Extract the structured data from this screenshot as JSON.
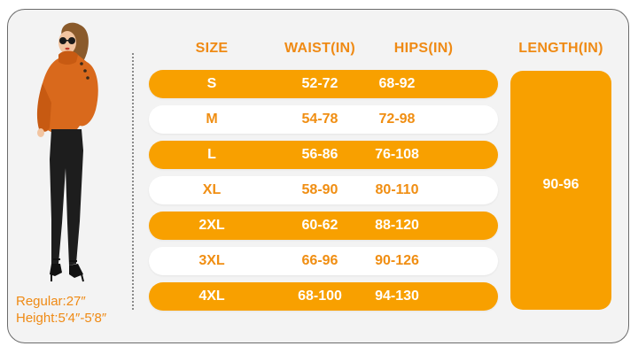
{
  "model": {
    "caption_regular": "Regular:27″",
    "caption_height": "Height:5′4″-5′8″"
  },
  "table": {
    "headers": {
      "size": "SIZE",
      "waist": "WAIST(IN)",
      "hips": "HIPS(IN)",
      "length": "LENGTH(IN)"
    },
    "rows": [
      {
        "size": "S",
        "waist": "52-72",
        "hips": "68-92"
      },
      {
        "size": "M",
        "waist": "54-78",
        "hips": "72-98"
      },
      {
        "size": "L",
        "waist": "56-86",
        "hips": "76-108"
      },
      {
        "size": "XL",
        "waist": "58-90",
        "hips": "80-110"
      },
      {
        "size": "2XL",
        "waist": "60-62",
        "hips": "88-120"
      },
      {
        "size": "3XL",
        "waist": "66-96",
        "hips": "90-126"
      },
      {
        "size": "4XL",
        "waist": "68-100",
        "hips": "94-130"
      }
    ],
    "length_value": "90-96"
  },
  "colors": {
    "accent": "#f8a000",
    "text_orange": "#ef8a14",
    "border": "#6b6b6b"
  }
}
